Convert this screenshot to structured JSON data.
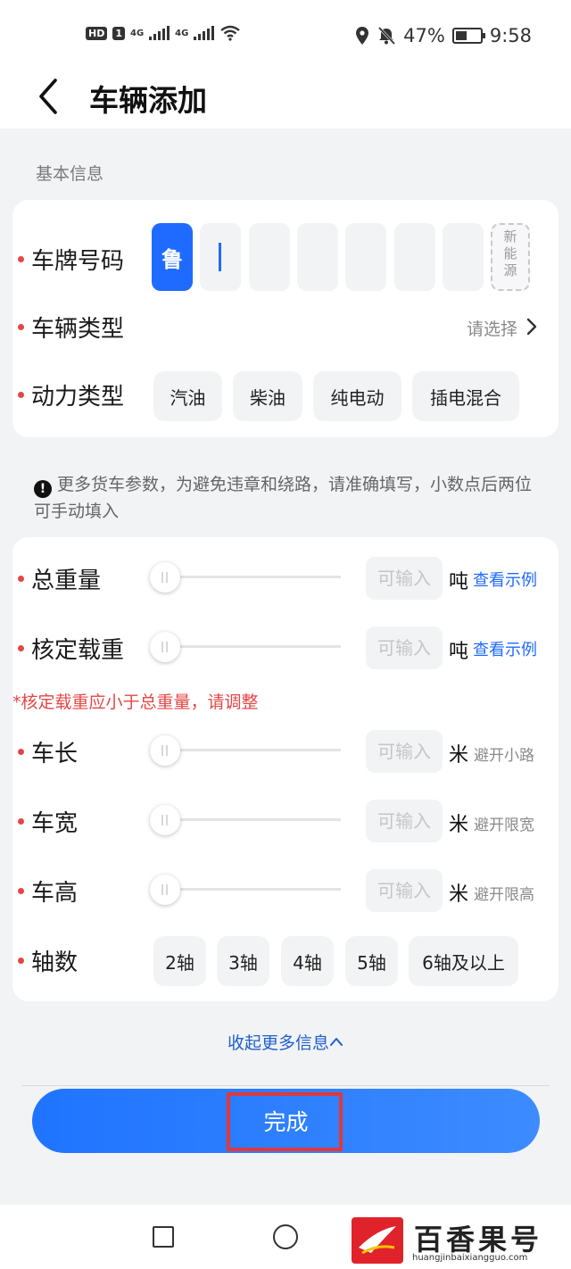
{
  "status_bar": {
    "hd_label": "HD",
    "sim_number": "1",
    "network_1": "4G",
    "network_2": "4G",
    "battery_percent": "47%",
    "time": "9:58",
    "icons": [
      "location-icon",
      "mute-bell-icon",
      "wifi-icon",
      "battery-icon"
    ]
  },
  "header": {
    "title": "车辆添加"
  },
  "basic_info": {
    "section_title": "基本信息",
    "plate": {
      "label": "车牌号码",
      "province": "鲁",
      "new_energy": "新能源",
      "slots": 6
    },
    "vehicle_type": {
      "label": "车辆类型",
      "placeholder": "请选择"
    },
    "power_type": {
      "label": "动力类型",
      "options": [
        "汽油",
        "柴油",
        "纯电动",
        "插电混合"
      ]
    }
  },
  "notice": {
    "text": "更多货车参数，为避免违章和绕路，请准确填写，小数点后两位可手动填入"
  },
  "truck_params": {
    "input_placeholder": "可输入",
    "total_weight": {
      "label": "总重量",
      "unit": "吨",
      "link": "查看示例"
    },
    "rated_load": {
      "label": "核定载重",
      "unit": "吨",
      "link": "查看示例"
    },
    "error": "*核定载重应小于总重量，请调整",
    "length": {
      "label": "车长",
      "unit": "米",
      "hint": "避开小路"
    },
    "width": {
      "label": "车宽",
      "unit": "米",
      "hint": "避开限宽"
    },
    "height": {
      "label": "车高",
      "unit": "米",
      "hint": "避开限高"
    },
    "axles": {
      "label": "轴数",
      "options": [
        "2轴",
        "3轴",
        "4轴",
        "5轴",
        "6轴及以上"
      ]
    }
  },
  "collapse_link": "收起更多信息",
  "done_button": "完成",
  "watermark": {
    "name": "百香果号",
    "url": "huangjinbaixiangguo.com"
  },
  "colors": {
    "primary": "#1f6bff",
    "error": "#e64545",
    "background": "#f2f3f5"
  }
}
